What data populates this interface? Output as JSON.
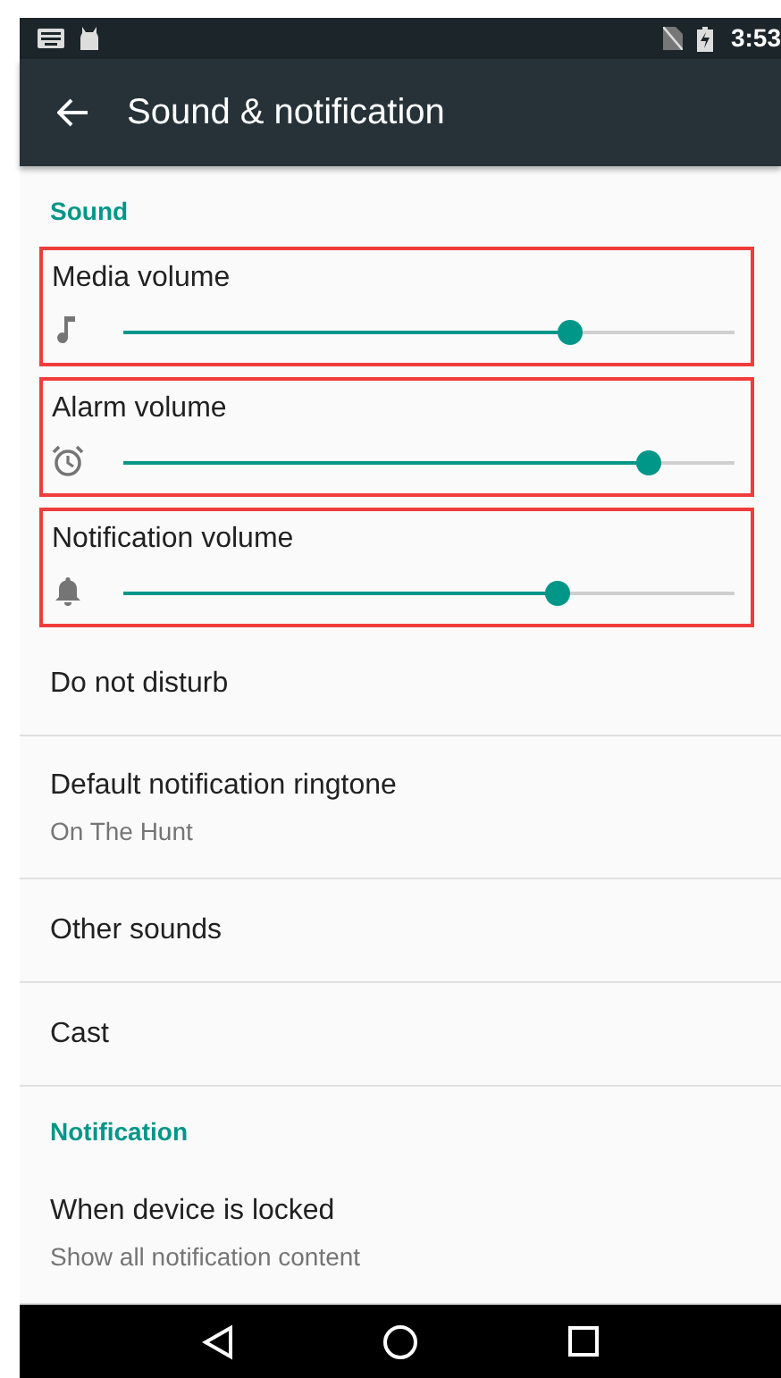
{
  "status_bar": {
    "time": "3:53"
  },
  "toolbar": {
    "title": "Sound & notification"
  },
  "sections": [
    {
      "header": "Sound",
      "items": [
        {
          "kind": "slider",
          "title": "Media volume",
          "level": 0.73,
          "highlighted": true
        },
        {
          "kind": "slider",
          "title": "Alarm volume",
          "level": 0.86,
          "highlighted": true
        },
        {
          "kind": "slider",
          "title": "Notification volume",
          "level": 0.71,
          "highlighted": true
        },
        {
          "kind": "item",
          "title": "Do not disturb"
        },
        {
          "kind": "item",
          "title": "Default notification ringtone",
          "subtitle": "On The Hunt"
        },
        {
          "kind": "item",
          "title": "Other sounds"
        },
        {
          "kind": "item",
          "title": "Cast"
        }
      ]
    },
    {
      "header": "Notification",
      "items": [
        {
          "kind": "item",
          "title": "When device is locked",
          "subtitle": "Show all notification content"
        }
      ]
    }
  ]
}
